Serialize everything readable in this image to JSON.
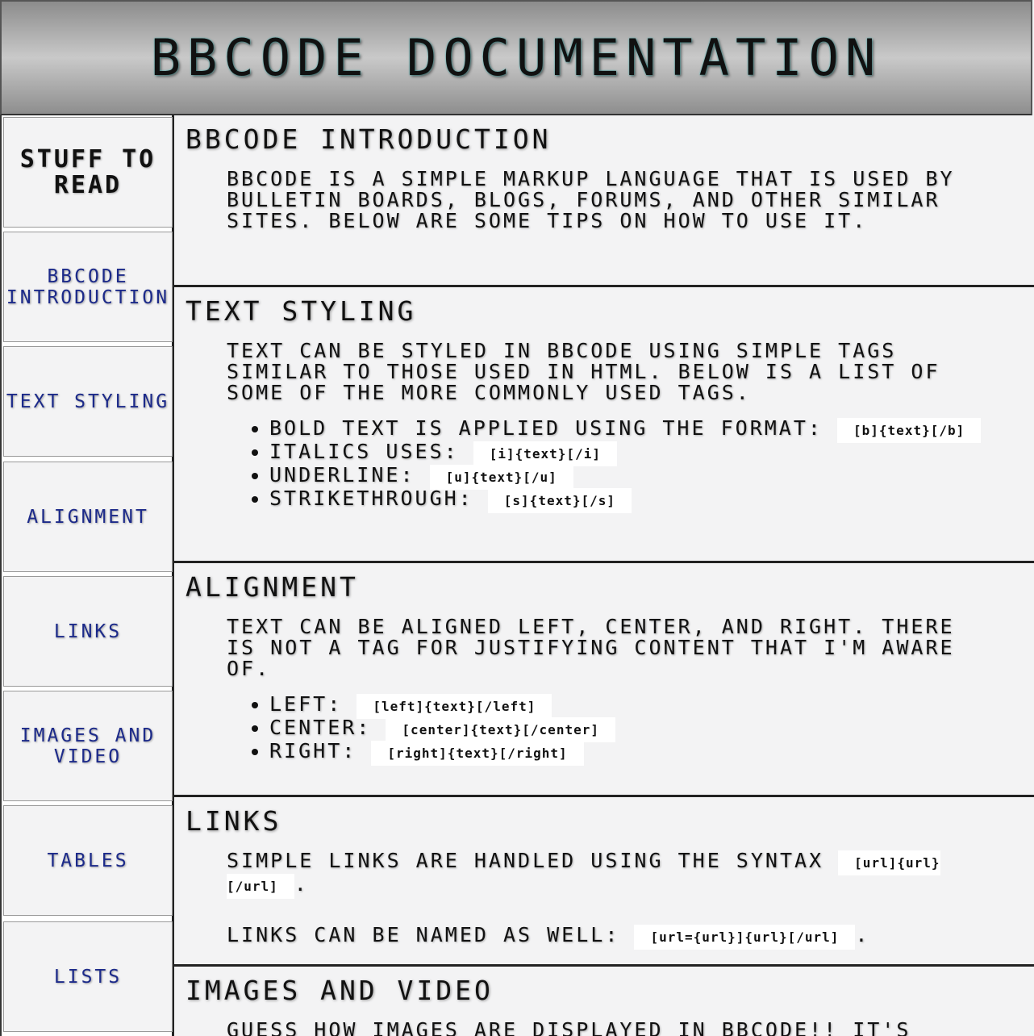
{
  "header": {
    "title": "BBCode Documentation"
  },
  "sidebar": {
    "heading": "Stuff to Read",
    "items": [
      {
        "label": "BBCode Introduction"
      },
      {
        "label": "Text Styling"
      },
      {
        "label": "Alignment"
      },
      {
        "label": "Links"
      },
      {
        "label": "Images and Video"
      },
      {
        "label": "Tables"
      },
      {
        "label": "Lists"
      }
    ]
  },
  "sections": {
    "intro": {
      "title": "BBCode Introduction",
      "body": "BBCode is a simple markup language that is used by bulletin boards, blogs, forums, and other similar sites. Below are some tips on how to use it."
    },
    "styling": {
      "title": "Text Styling",
      "body": "Text can be styled in BBCode using simple tags similar to those used in HTML. Below is a list of some of the more commonly used tags.",
      "items": [
        {
          "label": "Bold text is applied using the format:",
          "code": "[b]{text}[/b]"
        },
        {
          "label": "Italics uses:",
          "code": "[i]{text}[/i]"
        },
        {
          "label": "Underline:",
          "code": "[u]{text}[/u]"
        },
        {
          "label": "Strikethrough:",
          "code": "[s]{text}[/s]"
        }
      ]
    },
    "alignment": {
      "title": "Alignment",
      "body": "Text can be aligned left, center, and right. There is not a tag for justifying content that I'm aware of.",
      "items": [
        {
          "label": "Left:",
          "code": "[left]{text}[/left]"
        },
        {
          "label": "Center:",
          "code": "[center]{text}[/center]"
        },
        {
          "label": "Right:",
          "code": "[right]{text}[/right]"
        }
      ]
    },
    "links": {
      "title": "Links",
      "p1": "Simple links are handled using the syntax",
      "p1_code": "[url]{url}[/url]",
      "p2": "Links can be named as well:",
      "p2_code": "[url={url}]{url}[/url]",
      "period": "."
    },
    "images": {
      "title": "Images and Video",
      "body": "Guess how images are displayed in BBCode!! It's"
    }
  }
}
